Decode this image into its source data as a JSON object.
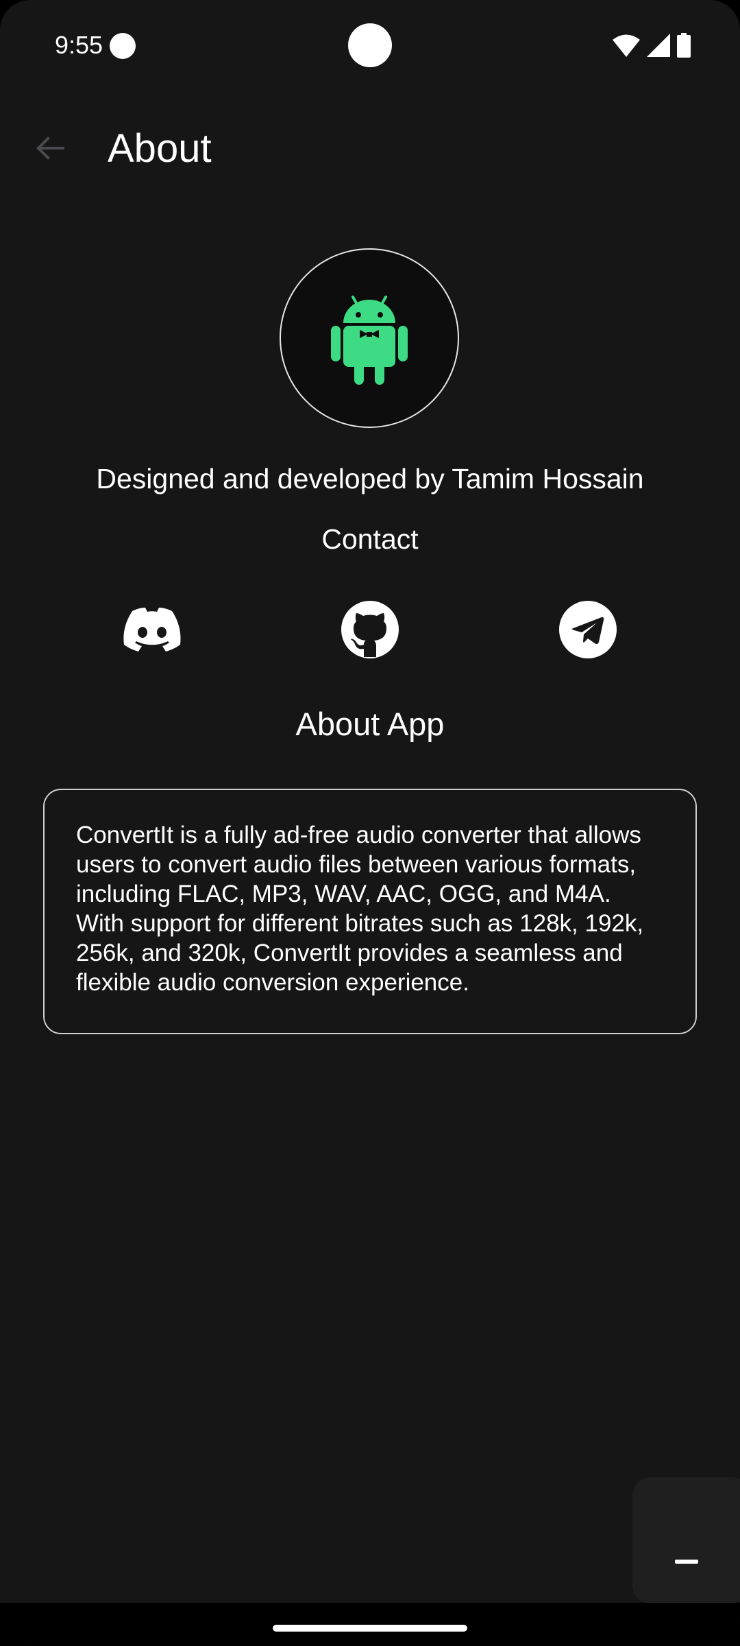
{
  "status_bar": {
    "time": "9:55"
  },
  "app_bar": {
    "title": "About",
    "back_icon": "arrow-back-icon"
  },
  "avatar": {
    "icon": "android-bowtie-icon",
    "accent_color": "#3ddc84"
  },
  "developer_text": "Designed and developed by Tamim Hossain",
  "contact": {
    "heading": "Contact",
    "links": [
      {
        "icon": "discord-icon"
      },
      {
        "icon": "github-icon"
      },
      {
        "icon": "telegram-icon"
      }
    ]
  },
  "about_app": {
    "heading": "About App",
    "description": "ConvertIt is a fully ad-free audio converter that allows users to convert audio files between various formats, including FLAC, MP3, WAV, AAC, OGG, and M4A. With support for different bitrates such as 128k, 192k, 256k, and 320k, ConvertIt provides a seamless and flexible audio conversion experience."
  },
  "floating_widget": {
    "icon": "minimize-icon"
  },
  "colors": {
    "background": "#161616",
    "text": "#ffffff",
    "card_border": "#cfcfcf"
  }
}
